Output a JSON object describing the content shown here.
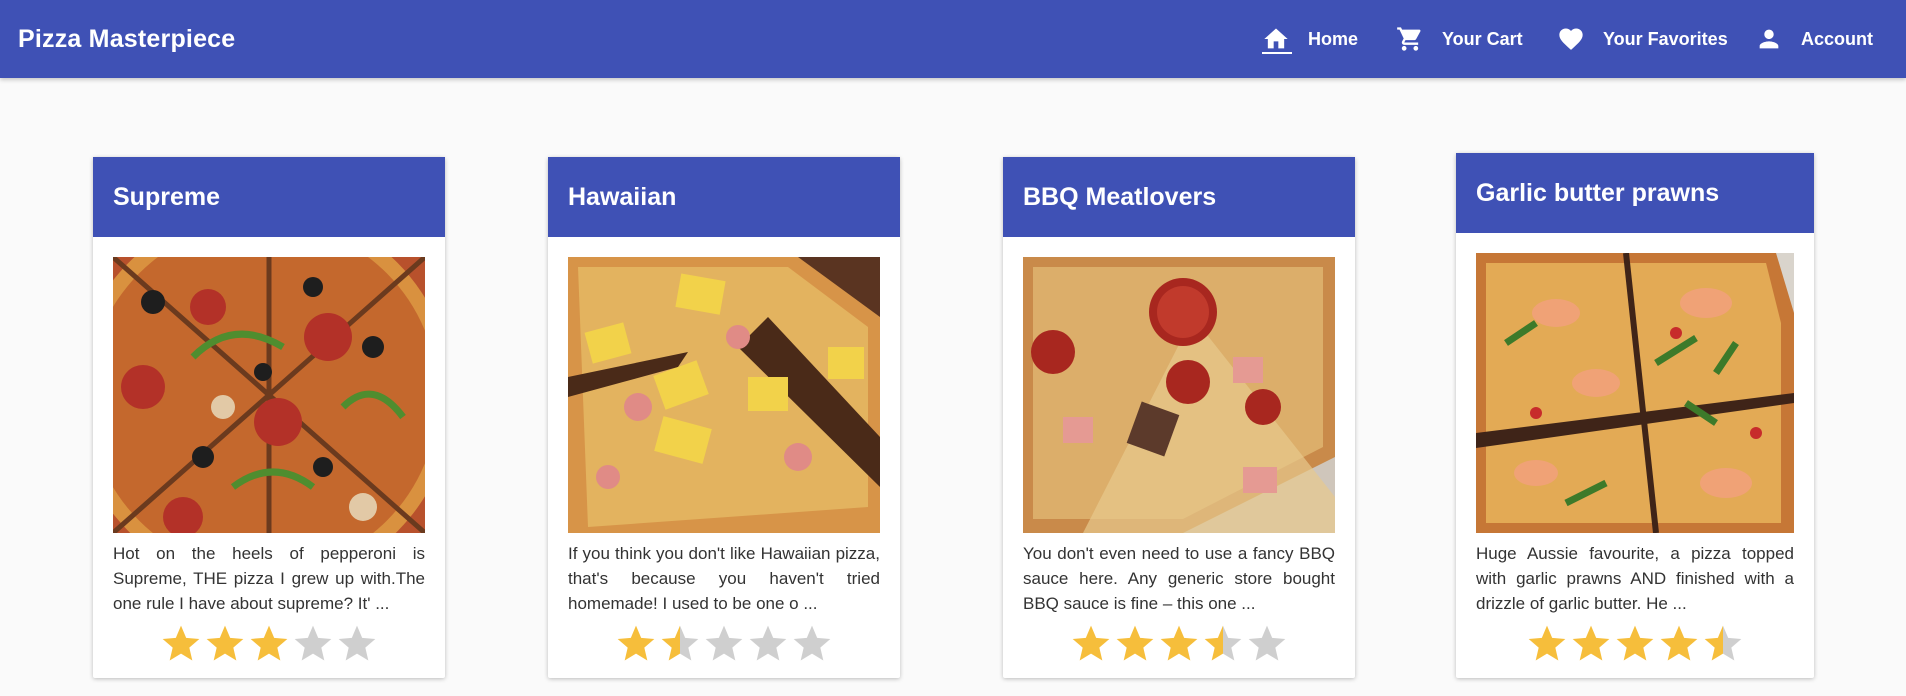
{
  "app": {
    "title": "Pizza Masterpiece"
  },
  "nav": {
    "home": {
      "label": "Home",
      "icon": "home-icon"
    },
    "cart": {
      "label": "Your Cart",
      "icon": "cart-icon"
    },
    "favorites": {
      "label": "Your Favorites",
      "icon": "heart-icon"
    },
    "account": {
      "label": "Account",
      "icon": "person-icon"
    }
  },
  "colors": {
    "primary": "#3f51b5",
    "star_filled": "#f6be3b",
    "star_empty": "#cfcfcf",
    "background": "#fafafa"
  },
  "pizzas": [
    {
      "name": "Supreme",
      "description": "Hot on the heels of pepperoni is Supreme, THE pizza I grew up with.The one rule I have about supreme? It' ...",
      "rating": 3,
      "max_rating": 5
    },
    {
      "name": "Hawaiian",
      "description": "If you think you don't like Hawaiian pizza, that's because you haven't tried homemade! I used to be one o ...",
      "rating": 1.5,
      "max_rating": 5
    },
    {
      "name": "BBQ Meatlovers",
      "description": "You don't even need to use a fancy BBQ sauce here. Any generic store bought BBQ sauce is fine – this one ...",
      "rating": 3.5,
      "max_rating": 5
    },
    {
      "name": "Garlic butter prawns",
      "description": "Huge Aussie favourite, a pizza topped with garlic prawns AND finished with a drizzle of garlic butter. He ...",
      "rating": 4.5,
      "max_rating": 5
    }
  ]
}
